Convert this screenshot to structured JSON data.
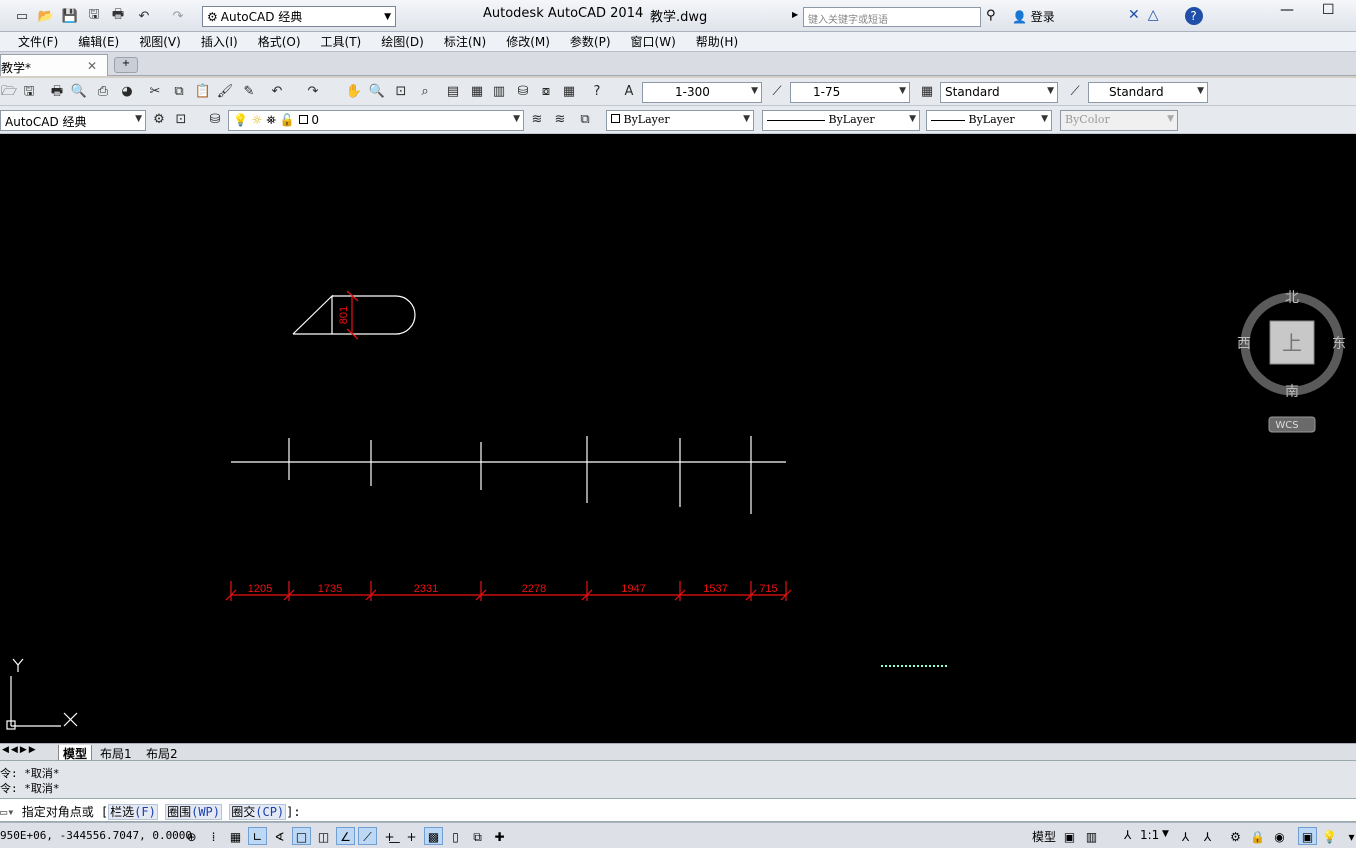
{
  "titlebar": {
    "workspace": "AutoCAD 经典",
    "app_title": "Autodesk AutoCAD 2014",
    "file_name": "教学.dwg",
    "search_placeholder": "键入关键字或短语",
    "login": "登录"
  },
  "menu": [
    "文件(F)",
    "编辑(E)",
    "视图(V)",
    "插入(I)",
    "格式(O)",
    "工具(T)",
    "绘图(D)",
    "标注(N)",
    "修改(M)",
    "参数(P)",
    "窗口(W)",
    "帮助(H)"
  ],
  "tabs": {
    "document": "教学*"
  },
  "toolbar1": {
    "annotation_scale": "1-300",
    "dim_scale": "1-75",
    "text_style": "Standard",
    "dim_style": "Standard"
  },
  "toolbar2": {
    "workspace": "AutoCAD 经典",
    "layer": "0",
    "color": "ByLayer",
    "linetype": "ByLayer",
    "lineweight": "ByLayer",
    "plotstyle": "ByColor"
  },
  "drawing": {
    "vertical_dim": "801",
    "dims": [
      "1205",
      "1735",
      "2331",
      "2278",
      "1947",
      "1537",
      "715"
    ],
    "ucs_x": "X",
    "ucs_y": "Y"
  },
  "viewcube": {
    "north": "北",
    "south": "南",
    "east": "东",
    "west": "西",
    "face": "上",
    "wcs": "WCS"
  },
  "layout_tabs": [
    "模型",
    "布局1",
    "布局2"
  ],
  "command": {
    "history": [
      "令: *取消*",
      "令: *取消*"
    ],
    "prompt": "指定对角点或 [",
    "options": [
      {
        "label": "栏选",
        "key": "(F)"
      },
      {
        "label": "圈围",
        "key": "(WP)"
      },
      {
        "label": "圈交",
        "key": "(CP)"
      }
    ],
    "suffix": "]:"
  },
  "status": {
    "coords": "950E+06, -344556.7047, 0.0000",
    "model": "模型",
    "scale": "1:1"
  }
}
